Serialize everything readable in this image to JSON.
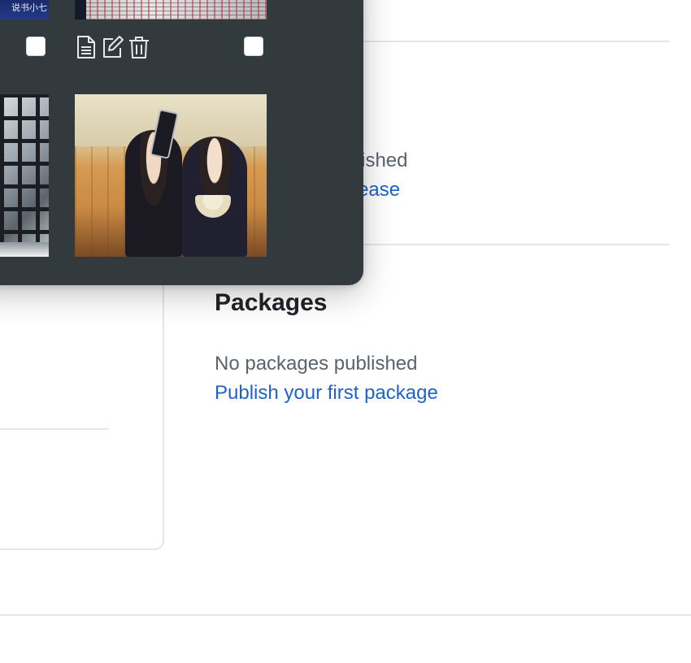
{
  "sidebar": {
    "releases": {
      "empty_text": "No releases published",
      "create_link": "Create a new release"
    },
    "packages": {
      "heading": "Packages",
      "empty_text": "No packages published",
      "publish_link": "Publish your first package"
    }
  },
  "image_picker": {
    "thumbnails": [
      {
        "name": "thumbnail-top-left",
        "caption": "说书小七"
      },
      {
        "name": "thumbnail-top-right"
      },
      {
        "name": "thumbnail-middle-left"
      },
      {
        "name": "thumbnail-middle-right"
      }
    ],
    "actions": [
      "document-icon",
      "edit-icon",
      "trash-icon"
    ]
  },
  "colors": {
    "link": "#1f62c9",
    "popup_bg": "#323a3e",
    "divider": "#e3e6ea"
  }
}
